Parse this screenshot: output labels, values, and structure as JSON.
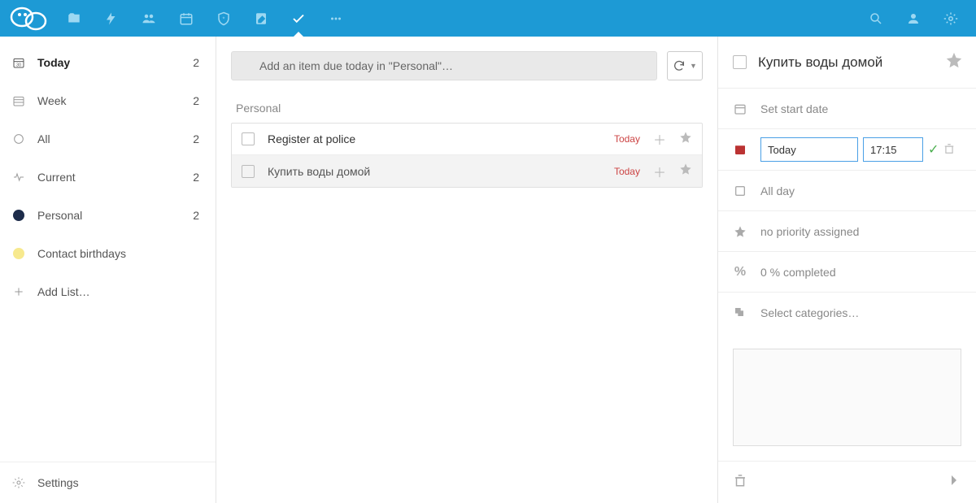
{
  "sidebar": {
    "items": [
      {
        "key": "today",
        "label": "Today",
        "count": "2",
        "icon": "cal-today",
        "selected": true
      },
      {
        "key": "week",
        "label": "Week",
        "count": "2",
        "icon": "cal-week"
      },
      {
        "key": "all",
        "label": "All",
        "count": "2",
        "icon": "circle"
      },
      {
        "key": "current",
        "label": "Current",
        "count": "2",
        "icon": "pulse"
      },
      {
        "key": "personal",
        "label": "Personal",
        "count": "2",
        "dot": "#1d2c4a"
      },
      {
        "key": "birthdays",
        "label": "Contact birthdays",
        "count": "",
        "dot": "#f7e98e"
      },
      {
        "key": "add",
        "label": "Add List…",
        "count": "",
        "icon": "plus"
      }
    ],
    "settings": "Settings"
  },
  "content": {
    "addPlaceholder": "Add an item due today in \"Personal\"…",
    "section": "Personal",
    "tasks": [
      {
        "title": "Register at police",
        "due": "Today",
        "selected": false
      },
      {
        "title": "Купить воды домой",
        "due": "Today",
        "selected": true
      }
    ]
  },
  "details": {
    "title": "Купить воды домой",
    "startDate": "Set start date",
    "dueDate": "Today",
    "dueTime": "17:15",
    "allDay": "All day",
    "priority": "no priority assigned",
    "completed": "0 % completed",
    "categories": "Select categories…"
  }
}
